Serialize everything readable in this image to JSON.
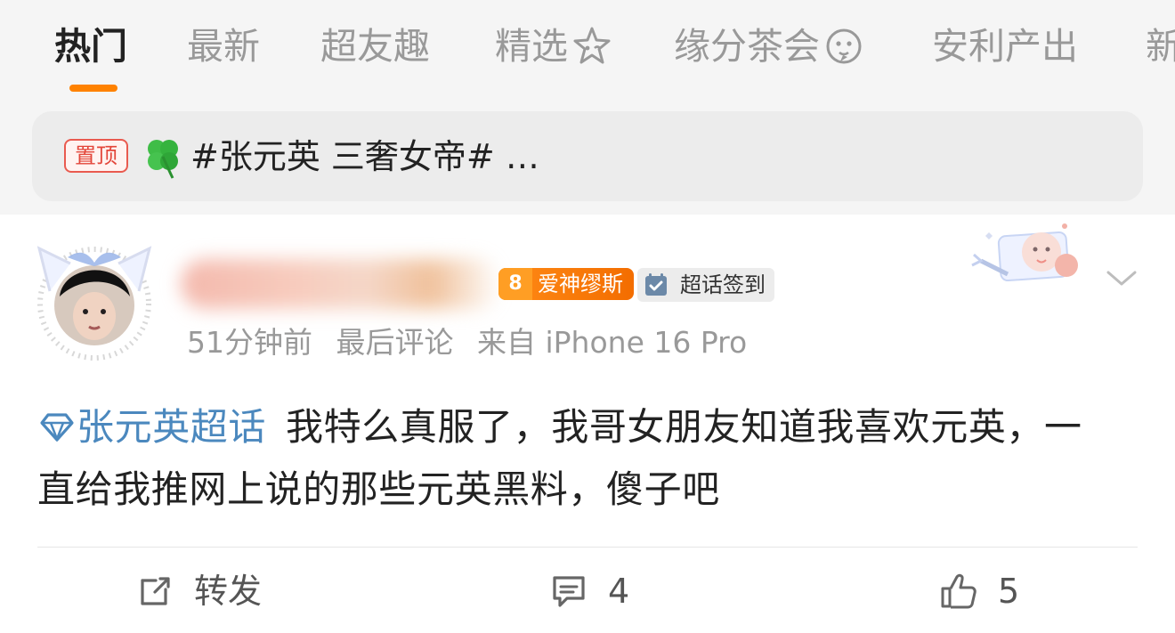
{
  "tabs": [
    {
      "label": "热门",
      "active": true
    },
    {
      "label": "最新",
      "active": false
    },
    {
      "label": "超友趣",
      "active": false
    },
    {
      "label": "精选",
      "active": false
    },
    {
      "label": "缘分茶会",
      "active": false
    },
    {
      "label": "安利产出",
      "active": false
    },
    {
      "label": "新",
      "active": false
    }
  ],
  "pinned": {
    "badge": "置顶",
    "text": "#张元英 三奢女帝# …"
  },
  "post": {
    "badges": {
      "love_level": "8",
      "love_label": "爱神缪斯",
      "checkin_label": "超话签到"
    },
    "meta": {
      "time": "51分钟前",
      "last_comment": "最后评论",
      "source": "来自 iPhone 16 Pro"
    },
    "topic": "张元英超话",
    "content": "我特么真服了，我哥女朋友知道我喜欢元英，一直给我推网上说的那些元英黑料，傻子吧",
    "actions": {
      "repost": "转发",
      "comments": "4",
      "likes": "5"
    }
  },
  "colors": {
    "accent": "#ff8200",
    "topic_link": "#4b88be",
    "pinned_badge": "#e3463a"
  },
  "icons": {
    "tab_selected": "sparkle-face-icon",
    "tab_tea": "chat-face-icon",
    "pin": "clover-icon",
    "topic": "diamond-icon",
    "checkin": "check-calendar-icon",
    "menu": "chevron-down-icon",
    "repost": "share-edit-icon",
    "comment": "comment-icon",
    "like": "thumbs-up-icon"
  }
}
